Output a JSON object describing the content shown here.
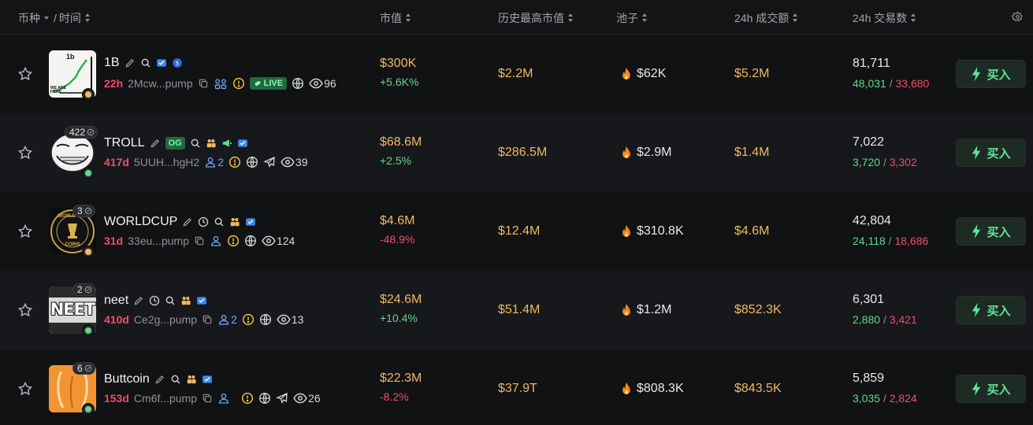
{
  "header": {
    "coin_label": "币种",
    "separator": "/",
    "time_label": "时间",
    "mcap_label": "市值",
    "ath_label": "历史最高市值",
    "pool_label": "池子",
    "volume_label": "24h 成交额",
    "tx_label": "24h 交易数"
  },
  "rows": [
    {
      "name": "1B",
      "age": "22h",
      "address": "2Mcw...pump",
      "avatar_text": "1b",
      "avatar_subtext": "WE ARE HERE",
      "live_label": "LIVE",
      "views": "96",
      "mcap": "$300K",
      "change": "+5.6K%",
      "ath": "$2.2M",
      "pool": "$62K",
      "volume": "$5.2M",
      "tx_total": "81,711",
      "tx_buy": "48,031",
      "tx_sell": "33,680",
      "buy_label": "买入"
    },
    {
      "name": "TROLL",
      "age": "417d",
      "address": "5UUH...hgH2",
      "count_badge": "422",
      "og_label": "OG",
      "holders": "2",
      "views": "39",
      "mcap": "$68.6M",
      "change": "+2.5%",
      "ath": "$286.5M",
      "pool": "$2.9M",
      "volume": "$1.4M",
      "tx_total": "7,022",
      "tx_buy": "3,720",
      "tx_sell": "3,302",
      "buy_label": "买入"
    },
    {
      "name": "WORLDCUP",
      "age": "31d",
      "address": "33eu...pump",
      "count_badge": "3",
      "avatar_text": "WORLD CUP",
      "avatar_subtext": "COINS",
      "views": "124",
      "mcap": "$4.6M",
      "change": "-48.9%",
      "ath": "$12.4M",
      "pool": "$310.8K",
      "volume": "$4.6M",
      "tx_total": "42,804",
      "tx_buy": "24,118",
      "tx_sell": "18,686",
      "buy_label": "买入"
    },
    {
      "name": "neet",
      "age": "410d",
      "address": "Ce2g...pump",
      "count_badge": "2",
      "avatar_text": "NEET",
      "holders": "2",
      "views": "13",
      "mcap": "$24.6M",
      "change": "+10.4%",
      "ath": "$51.4M",
      "pool": "$1.2M",
      "volume": "$852.3K",
      "tx_total": "6,301",
      "tx_buy": "2,880",
      "tx_sell": "3,421",
      "buy_label": "买入"
    },
    {
      "name": "Buttcoin",
      "age": "153d",
      "address": "Cm6f...pump",
      "count_badge": "6",
      "views": "26",
      "mcap": "$22.3M",
      "change": "-8.2%",
      "ath": "$37.9T",
      "pool": "$808.3K",
      "volume": "$843.5K",
      "tx_total": "5,859",
      "tx_buy": "3,035",
      "tx_sell": "2,824",
      "buy_label": "买入"
    }
  ],
  "colors": {
    "background": "#111214",
    "row_alt": "#17181b",
    "gold": "#f0b860",
    "green": "#5fd98c",
    "red": "#ef4d6b",
    "buy_text": "#62e39a"
  }
}
